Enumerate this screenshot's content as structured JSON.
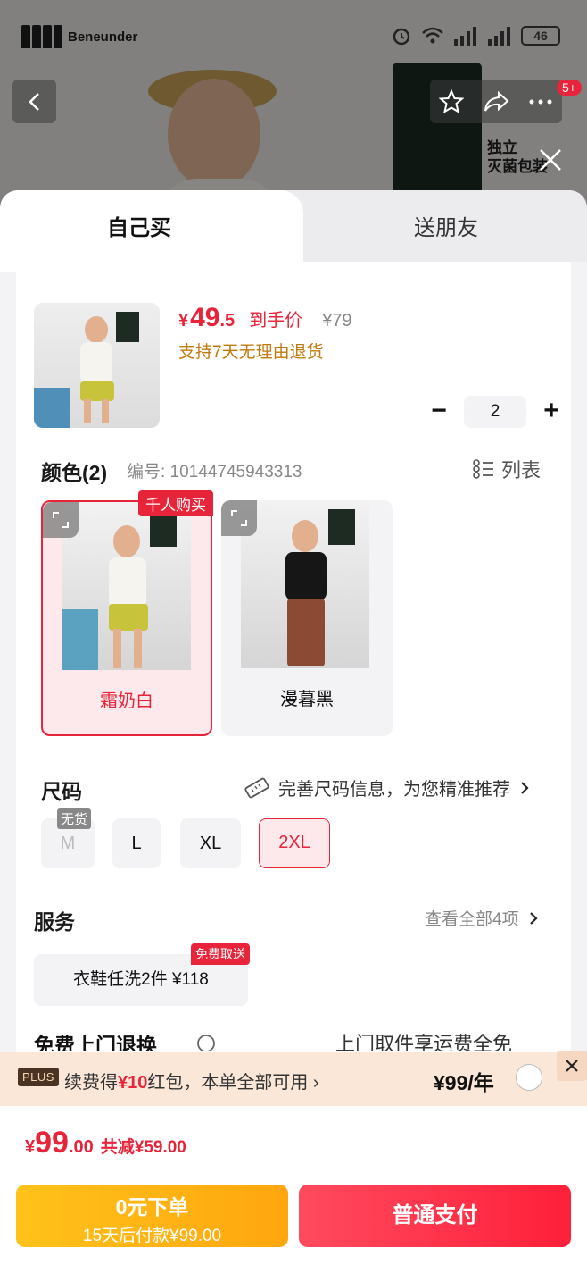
{
  "status_bar": {
    "brand_name": "Beneunder",
    "battery": "46"
  },
  "background": {
    "pack_label_line1": "独立",
    "pack_label_line2": "灭菌包装",
    "badge": "5+"
  },
  "tabs": [
    {
      "label": "自己买",
      "active": true
    },
    {
      "label": "送朋友",
      "active": false
    }
  ],
  "product": {
    "price_symbol": "¥",
    "price_integer": "49",
    "price_decimal": ".5",
    "price_tag": "到手价",
    "original_price": "¥79",
    "return_policy": "支持7天无理由退货",
    "quantity": "2"
  },
  "color_section": {
    "title": "颜色(2)",
    "code": "编号: 10144745943313",
    "list_toggle": "列表",
    "options": [
      {
        "name": "霜奶白",
        "selected": true,
        "badge": "千人购买"
      },
      {
        "name": "漫暮黑",
        "selected": false
      }
    ]
  },
  "size_section": {
    "title": "尺码",
    "hint": "完善尺码信息，为您精准推荐",
    "out_of_stock": "无货",
    "options": [
      {
        "label": "M",
        "disabled": true
      },
      {
        "label": "L"
      },
      {
        "label": "XL"
      },
      {
        "label": "2XL",
        "selected": true
      }
    ]
  },
  "service_section": {
    "title": "服务",
    "view_all": "查看全部4项",
    "chip": "衣鞋任洗2件 ¥118",
    "chip_badge": "免费取送"
  },
  "partial_row": {
    "left": "免费上门退换",
    "right": "上门取件享运费全免"
  },
  "plus_bar": {
    "logo": "PLUS",
    "text_prefix": "续费得",
    "text_highlight": "¥10",
    "text_suffix": "红包，本单全部可用",
    "price": "¥99/年"
  },
  "total": {
    "symbol": "¥",
    "integer": "99",
    "decimal": ".00",
    "savings": "共减¥59.00"
  },
  "buttons": {
    "credit_line1": "0元下单",
    "credit_line2": "15天后付款¥99.00",
    "pay": "普通支付"
  },
  "colors": {
    "accent": "#e8243a",
    "gold": "#ffb515",
    "note": "#c27a0e"
  }
}
